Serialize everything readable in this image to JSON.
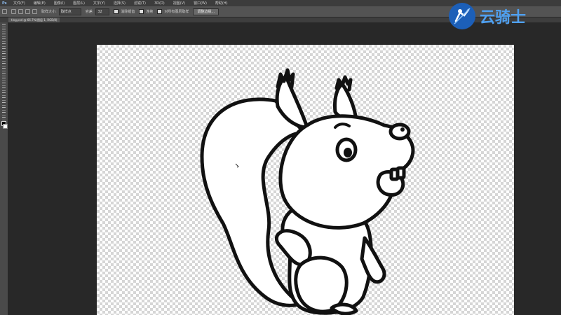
{
  "app": {
    "logo": "Ps"
  },
  "menu": [
    "文件(F)",
    "编辑(E)",
    "图像(I)",
    "图层(L)",
    "文字(Y)",
    "选择(S)",
    "滤镜(T)",
    "3D(D)",
    "视图(V)",
    "窗口(W)",
    "帮助(H)"
  ],
  "options": {
    "sample_size_label": "取样大小:",
    "sample_size_value": "取样点",
    "tolerance_label": "容差:",
    "tolerance_value": "32",
    "antialias_label": "消除锯齿",
    "contiguous_label": "连续",
    "sample_all_layers_label": "对所有图层取样",
    "refine_edge_button": "调整边缘..."
  },
  "document": {
    "tab_label": "ting.psd @ 66.7%(图层 1, RGB/8)"
  },
  "watermark": {
    "text": "云骑士"
  },
  "tools": [
    "move",
    "marquee",
    "lasso",
    "quick-select",
    "crop",
    "eyedropper",
    "healing",
    "brush",
    "clone",
    "history-brush",
    "eraser",
    "gradient",
    "blur",
    "dodge",
    "pen",
    "type",
    "path-select",
    "shape",
    "hand",
    "zoom"
  ]
}
